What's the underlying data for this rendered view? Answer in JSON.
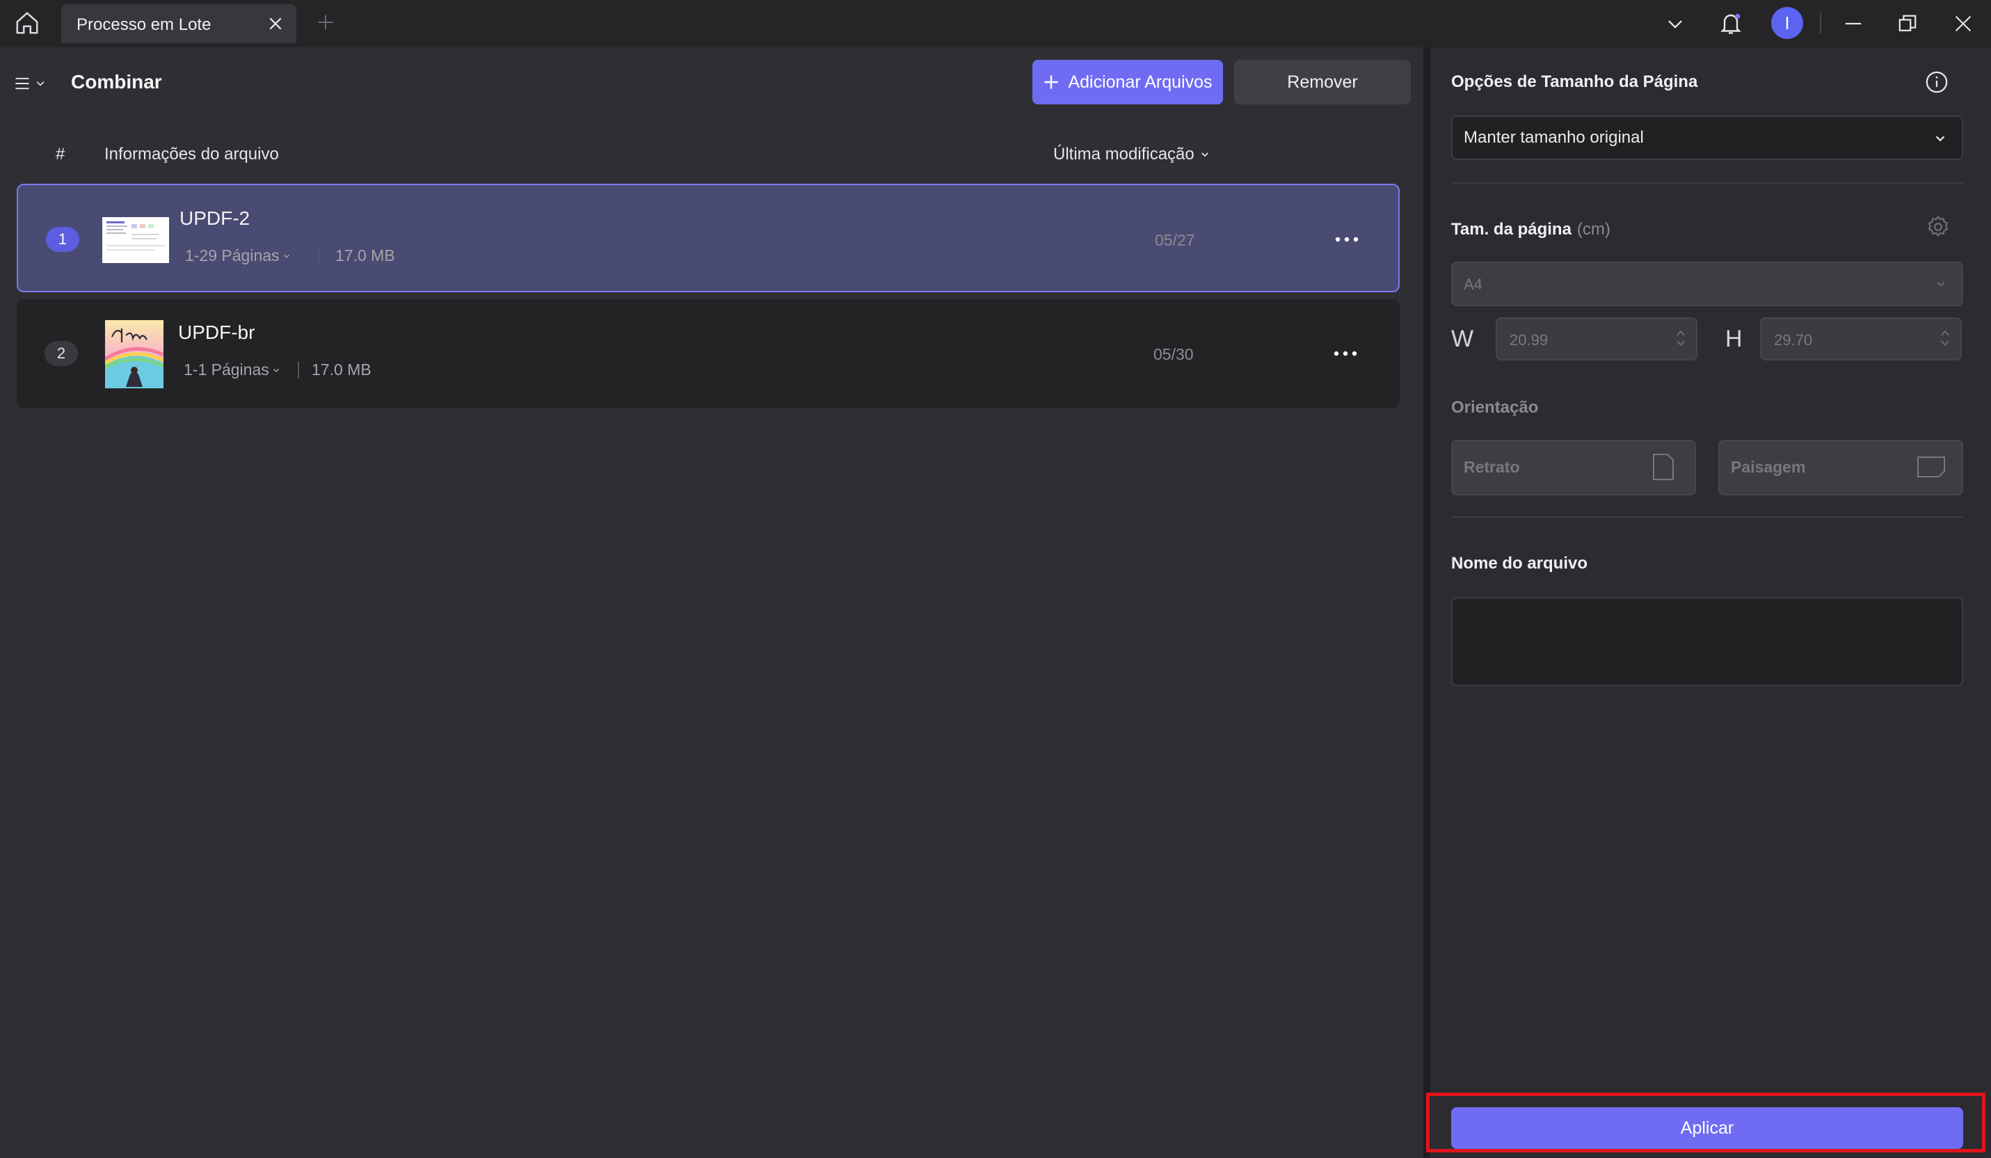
{
  "titlebar": {
    "tab_label": "Processo em Lote",
    "avatar_letter": "I",
    "icons": [
      "home-icon",
      "close-icon",
      "plus-icon",
      "chevron-down-icon",
      "bell-icon",
      "minimize-icon",
      "restore-icon",
      "close-window-icon"
    ]
  },
  "toolbar": {
    "title": "Combinar",
    "add_files_label": "Adicionar Arquivos",
    "remove_label": "Remover"
  },
  "table": {
    "col_index": "#",
    "col_info": "Informações do arquivo",
    "col_modified": "Última modificação",
    "rows": [
      {
        "index": "1",
        "name": "UPDF-2",
        "pages": "1-29 Páginas",
        "size": "17.0 MB",
        "date": "05/27",
        "selected": true
      },
      {
        "index": "2",
        "name": "UPDF-br",
        "pages": "1-1 Páginas",
        "size": "17.0 MB",
        "date": "05/30",
        "selected": false
      }
    ]
  },
  "panel": {
    "size_options_title": "Opções de Tamanho da Página",
    "size_option_value": "Manter tamanho original",
    "page_size_label": "Tam. da página",
    "page_size_unit": "(cm)",
    "paper_value": "A4",
    "w_label": "W",
    "w_value": "20.99",
    "h_label": "H",
    "h_value": "29.70",
    "orientation_label": "Orientação",
    "portrait_label": "Retrato",
    "landscape_label": "Paisagem",
    "filename_label": "Nome do arquivo",
    "filename_value": "",
    "apply_label": "Aplicar"
  },
  "colors": {
    "accent": "#6f6cf3",
    "highlight": "#e0141c",
    "selected_row": "#4a4b72"
  }
}
